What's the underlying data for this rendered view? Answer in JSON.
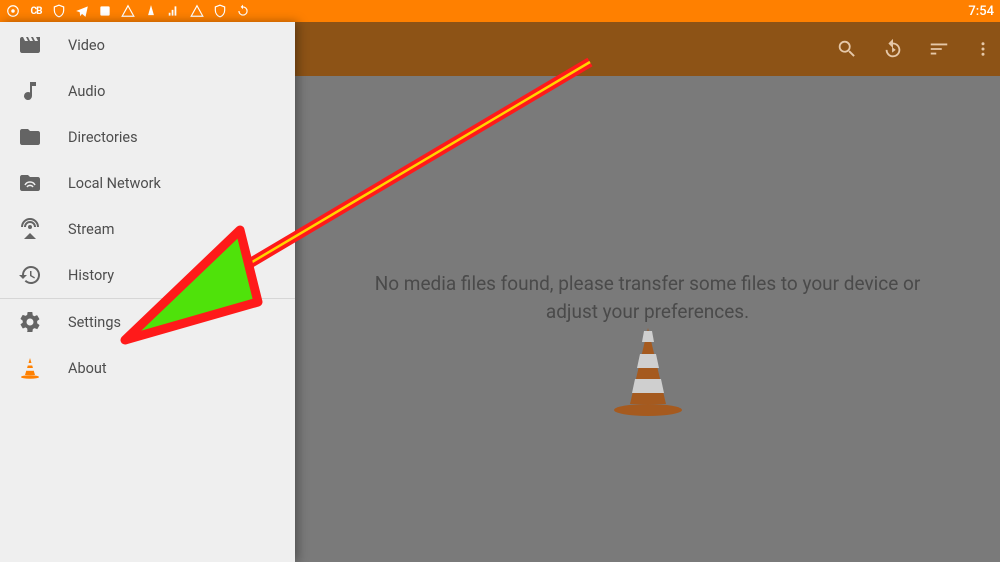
{
  "status_bar": {
    "time": "7:54"
  },
  "drawer": {
    "items_top": [
      {
        "label": "Video"
      },
      {
        "label": "Audio"
      },
      {
        "label": "Directories"
      },
      {
        "label": "Local Network"
      },
      {
        "label": "Stream"
      },
      {
        "label": "History"
      }
    ],
    "items_bottom": [
      {
        "label": "Settings"
      },
      {
        "label": "About"
      }
    ]
  },
  "main": {
    "empty_line1": "No media files found, please transfer some files to your device or",
    "empty_line2": "adjust your preferences."
  }
}
